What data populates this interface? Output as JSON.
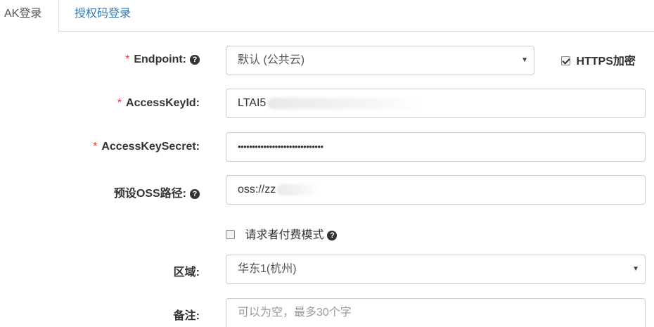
{
  "tabs": [
    {
      "label": "AK登录"
    },
    {
      "label": "授权码登录"
    }
  ],
  "form": {
    "endpoint": {
      "label": "Endpoint:",
      "value": "默认 (公共云)"
    },
    "https": {
      "label": "HTTPS加密",
      "checked": true
    },
    "access_key_id": {
      "label": "AccessKeyId:",
      "value": "LTAI5"
    },
    "access_key_secret": {
      "label": "AccessKeySecret:",
      "value": "••••••••••••••••••••••••••••••"
    },
    "oss_path": {
      "label": "预设OSS路径:",
      "value": "oss://zz"
    },
    "requester_pays": {
      "label": "请求者付费模式",
      "checked": false
    },
    "region": {
      "label": "区域:",
      "value": "华东1(杭州)"
    },
    "remark": {
      "label": "备注:",
      "placeholder": "可以为空，最多30个字"
    }
  },
  "required_mark": "*",
  "help_glyph": "?",
  "colors": {
    "required": "#e4393c",
    "link": "#337ab7",
    "border": "#cccccc"
  }
}
